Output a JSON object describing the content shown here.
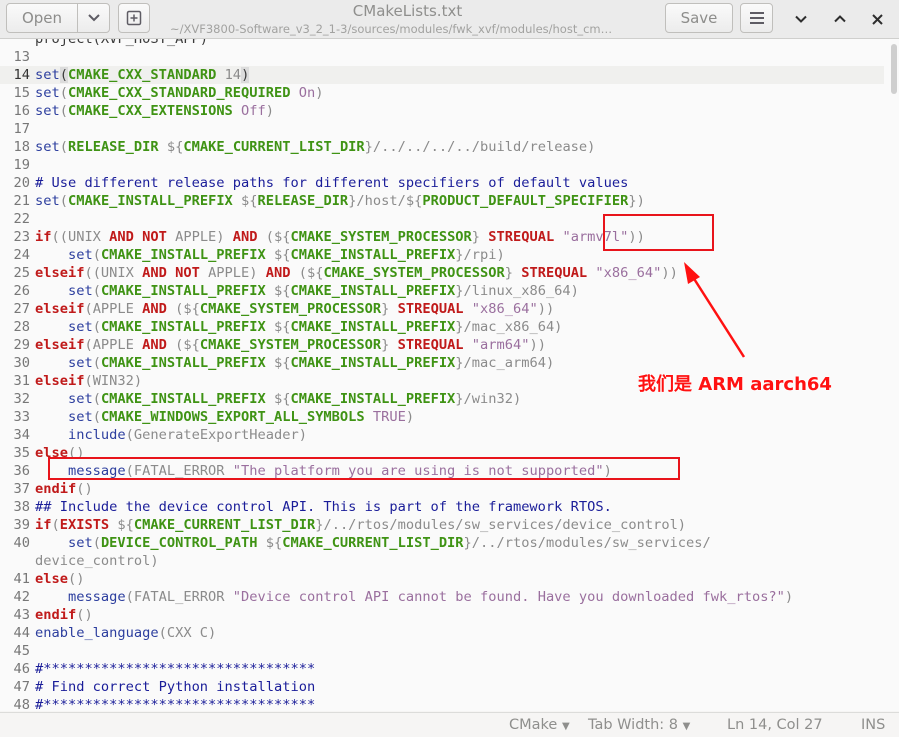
{
  "window": {
    "title": "CMakeLists.txt",
    "subtitle": "~/XVF3800-Software_v3_2_1-3/sources/modules/fwk_xvf/modules/host_cm…",
    "open_label": "Open",
    "save_label": "Save"
  },
  "annotation": {
    "text": "我们是 ARM aarch64",
    "color": "#ff1111"
  },
  "statusbar": {
    "language": "CMake",
    "tab_width": "Tab Width: 8",
    "position": "Ln 14, Col 27",
    "mode": "INS"
  },
  "lines": [
    {
      "n": "",
      "segs": [
        [
          "",
          "project(XVF_HOST_APP)"
        ]
      ]
    },
    {
      "n": "13",
      "segs": []
    },
    {
      "n": "14",
      "segs": [
        [
          "cm",
          "set"
        ],
        [
          "brk",
          "("
        ],
        [
          "v",
          "CMAKE_CXX_STANDARD"
        ],
        [
          "p",
          " 14"
        ],
        [
          "brk",
          ")"
        ]
      ]
    },
    {
      "n": "15",
      "segs": [
        [
          "cm",
          "set"
        ],
        [
          "p",
          "("
        ],
        [
          "v",
          "CMAKE_CXX_STANDARD_REQUIRED"
        ],
        [
          "s",
          " On"
        ],
        [
          "p",
          ")"
        ]
      ]
    },
    {
      "n": "16",
      "segs": [
        [
          "cm",
          "set"
        ],
        [
          "p",
          "("
        ],
        [
          "v",
          "CMAKE_CXX_EXTENSIONS"
        ],
        [
          "s",
          " Off"
        ],
        [
          "p",
          ")"
        ]
      ]
    },
    {
      "n": "17",
      "segs": []
    },
    {
      "n": "18",
      "segs": [
        [
          "cm",
          "set"
        ],
        [
          "p",
          "("
        ],
        [
          "v",
          "RELEASE_DIR"
        ],
        [
          "p",
          " ${"
        ],
        [
          "v",
          "CMAKE_CURRENT_LIST_DIR"
        ],
        [
          "p",
          "}/../../../../build/release)"
        ]
      ]
    },
    {
      "n": "19",
      "segs": []
    },
    {
      "n": "20",
      "segs": [
        [
          "c",
          "# Use different release paths for different specifiers of default values"
        ]
      ]
    },
    {
      "n": "21",
      "segs": [
        [
          "cm",
          "set"
        ],
        [
          "p",
          "("
        ],
        [
          "v",
          "CMAKE_INSTALL_PREFIX"
        ],
        [
          "p",
          " ${"
        ],
        [
          "v",
          "RELEASE_DIR"
        ],
        [
          "p",
          "}/host/${"
        ],
        [
          "v",
          "PRODUCT_DEFAULT_SPECIFIER"
        ],
        [
          "p",
          "})"
        ]
      ]
    },
    {
      "n": "22",
      "segs": []
    },
    {
      "n": "23",
      "segs": [
        [
          "k",
          "if"
        ],
        [
          "p",
          "((UNIX "
        ],
        [
          "k",
          "AND NOT"
        ],
        [
          "p",
          " APPLE) "
        ],
        [
          "k",
          "AND"
        ],
        [
          "p",
          " (${"
        ],
        [
          "v",
          "CMAKE_SYSTEM_PROCESSOR"
        ],
        [
          "p",
          "} "
        ],
        [
          "k",
          "STREQUAL"
        ],
        [
          "s",
          " \"armv7l\""
        ],
        [
          "p",
          "))"
        ]
      ]
    },
    {
      "n": "24",
      "segs": [
        [
          "cm",
          "    set"
        ],
        [
          "p",
          "("
        ],
        [
          "v",
          "CMAKE_INSTALL_PREFIX"
        ],
        [
          "p",
          " ${"
        ],
        [
          "v",
          "CMAKE_INSTALL_PREFIX"
        ],
        [
          "p",
          "}/rpi)"
        ]
      ]
    },
    {
      "n": "25",
      "segs": [
        [
          "k",
          "elseif"
        ],
        [
          "p",
          "((UNIX "
        ],
        [
          "k",
          "AND NOT"
        ],
        [
          "p",
          " APPLE) "
        ],
        [
          "k",
          "AND"
        ],
        [
          "p",
          " (${"
        ],
        [
          "v",
          "CMAKE_SYSTEM_PROCESSOR"
        ],
        [
          "p",
          "} "
        ],
        [
          "k",
          "STREQUAL"
        ],
        [
          "s",
          " \"x86_64\""
        ],
        [
          "p",
          "))"
        ]
      ]
    },
    {
      "n": "26",
      "segs": [
        [
          "cm",
          "    set"
        ],
        [
          "p",
          "("
        ],
        [
          "v",
          "CMAKE_INSTALL_PREFIX"
        ],
        [
          "p",
          " ${"
        ],
        [
          "v",
          "CMAKE_INSTALL_PREFIX"
        ],
        [
          "p",
          "}/linux_x86_64)"
        ]
      ]
    },
    {
      "n": "27",
      "segs": [
        [
          "k",
          "elseif"
        ],
        [
          "p",
          "(APPLE "
        ],
        [
          "k",
          "AND"
        ],
        [
          "p",
          " (${"
        ],
        [
          "v",
          "CMAKE_SYSTEM_PROCESSOR"
        ],
        [
          "p",
          "} "
        ],
        [
          "k",
          "STREQUAL"
        ],
        [
          "s",
          " \"x86_64\""
        ],
        [
          "p",
          "))"
        ]
      ]
    },
    {
      "n": "28",
      "segs": [
        [
          "cm",
          "    set"
        ],
        [
          "p",
          "("
        ],
        [
          "v",
          "CMAKE_INSTALL_PREFIX"
        ],
        [
          "p",
          " ${"
        ],
        [
          "v",
          "CMAKE_INSTALL_PREFIX"
        ],
        [
          "p",
          "}/mac_x86_64)"
        ]
      ]
    },
    {
      "n": "29",
      "segs": [
        [
          "k",
          "elseif"
        ],
        [
          "p",
          "(APPLE "
        ],
        [
          "k",
          "AND"
        ],
        [
          "p",
          " (${"
        ],
        [
          "v",
          "CMAKE_SYSTEM_PROCESSOR"
        ],
        [
          "p",
          "} "
        ],
        [
          "k",
          "STREQUAL"
        ],
        [
          "s",
          " \"arm64\""
        ],
        [
          "p",
          "))"
        ]
      ]
    },
    {
      "n": "30",
      "segs": [
        [
          "cm",
          "    set"
        ],
        [
          "p",
          "("
        ],
        [
          "v",
          "CMAKE_INSTALL_PREFIX"
        ],
        [
          "p",
          " ${"
        ],
        [
          "v",
          "CMAKE_INSTALL_PREFIX"
        ],
        [
          "p",
          "}/mac_arm64)"
        ]
      ]
    },
    {
      "n": "31",
      "segs": [
        [
          "k",
          "elseif"
        ],
        [
          "p",
          "(WIN32)"
        ]
      ]
    },
    {
      "n": "32",
      "segs": [
        [
          "cm",
          "    set"
        ],
        [
          "p",
          "("
        ],
        [
          "v",
          "CMAKE_INSTALL_PREFIX"
        ],
        [
          "p",
          " ${"
        ],
        [
          "v",
          "CMAKE_INSTALL_PREFIX"
        ],
        [
          "p",
          "}/win32)"
        ]
      ]
    },
    {
      "n": "33",
      "segs": [
        [
          "cm",
          "    set"
        ],
        [
          "p",
          "("
        ],
        [
          "v",
          "CMAKE_WINDOWS_EXPORT_ALL_SYMBOLS"
        ],
        [
          "s",
          " TRUE"
        ],
        [
          "p",
          ")"
        ]
      ]
    },
    {
      "n": "34",
      "segs": [
        [
          "cm",
          "    include"
        ],
        [
          "p",
          "(GenerateExportHeader)"
        ]
      ]
    },
    {
      "n": "35",
      "segs": [
        [
          "k",
          "else"
        ],
        [
          "p",
          "()"
        ]
      ]
    },
    {
      "n": "36",
      "segs": [
        [
          "cm",
          "    message"
        ],
        [
          "p",
          "(FATAL_ERROR "
        ],
        [
          "s",
          "\"The platform you are using is not supported\""
        ],
        [
          "p",
          ")"
        ]
      ]
    },
    {
      "n": "37",
      "segs": [
        [
          "k",
          "endif"
        ],
        [
          "p",
          "()"
        ]
      ]
    },
    {
      "n": "38",
      "segs": [
        [
          "c",
          "## Include the device control API. This is part of the framework RTOS."
        ]
      ]
    },
    {
      "n": "39",
      "segs": [
        [
          "k",
          "if"
        ],
        [
          "p",
          "("
        ],
        [
          "k",
          "EXISTS"
        ],
        [
          "p",
          " ${"
        ],
        [
          "v",
          "CMAKE_CURRENT_LIST_DIR"
        ],
        [
          "p",
          "}/../rtos/modules/sw_services/device_control)"
        ]
      ]
    },
    {
      "n": "40",
      "segs": [
        [
          "cm",
          "    set"
        ],
        [
          "p",
          "("
        ],
        [
          "v",
          "DEVICE_CONTROL_PATH"
        ],
        [
          "p",
          " ${"
        ],
        [
          "v",
          "CMAKE_CURRENT_LIST_DIR"
        ],
        [
          "p",
          "}/../rtos/modules/sw_services/"
        ]
      ]
    },
    {
      "n": "",
      "segs": [
        [
          "p",
          "device_control)"
        ]
      ]
    },
    {
      "n": "41",
      "segs": [
        [
          "k",
          "else"
        ],
        [
          "p",
          "()"
        ]
      ]
    },
    {
      "n": "42",
      "segs": [
        [
          "cm",
          "    message"
        ],
        [
          "p",
          "(FATAL_ERROR "
        ],
        [
          "s",
          "\"Device control API cannot be found. Have you downloaded fwk_rtos?\""
        ],
        [
          "p",
          ")"
        ]
      ]
    },
    {
      "n": "43",
      "segs": [
        [
          "k",
          "endif"
        ],
        [
          "p",
          "()"
        ]
      ]
    },
    {
      "n": "44",
      "segs": [
        [
          "cm",
          "enable_language"
        ],
        [
          "p",
          "(CXX C)"
        ]
      ]
    },
    {
      "n": "45",
      "segs": []
    },
    {
      "n": "46",
      "segs": [
        [
          "c",
          "#*********************************"
        ]
      ]
    },
    {
      "n": "47",
      "segs": [
        [
          "c",
          "# Find correct Python installation"
        ]
      ]
    },
    {
      "n": "48",
      "segs": [
        [
          "c",
          "#*********************************"
        ]
      ]
    }
  ]
}
